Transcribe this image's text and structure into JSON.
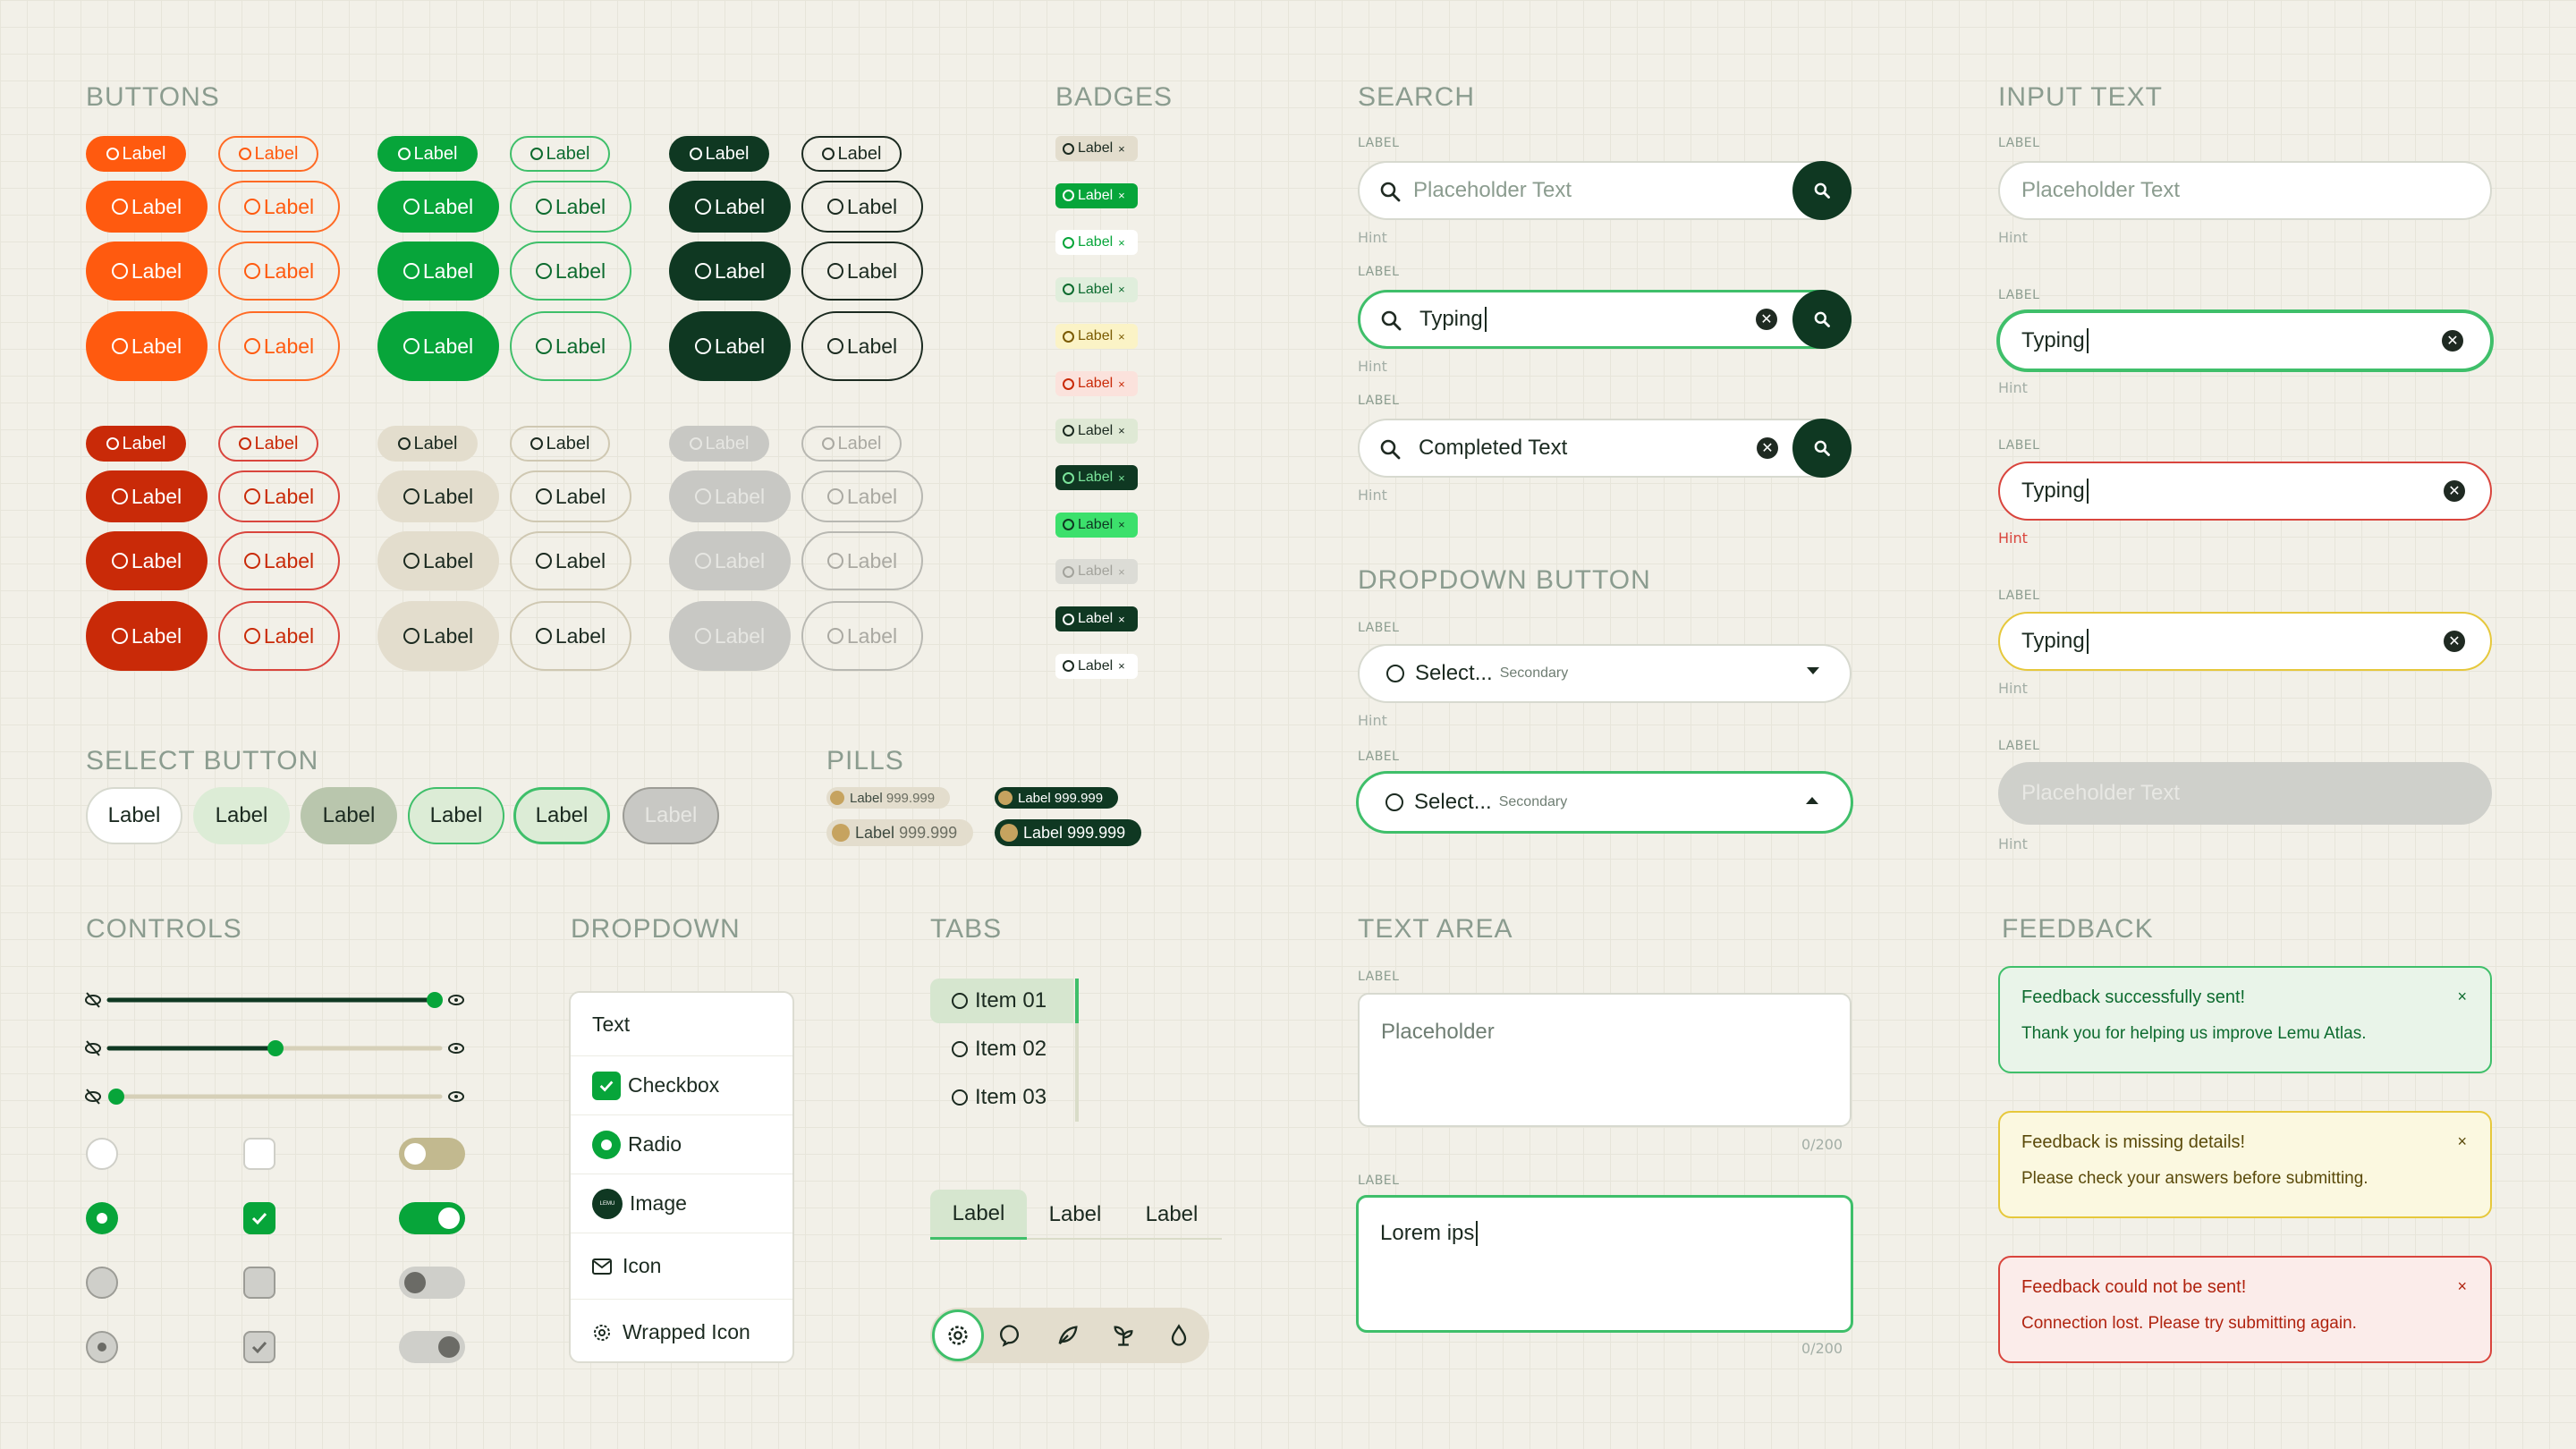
{
  "sections": {
    "buttons": "BUTTONS",
    "badges": "BADGES",
    "search": "SEARCH",
    "input_text": "INPUT TEXT",
    "select_button": "SELECT BUTTON",
    "pills": "PILLS",
    "dropdown_button": "DROPDOWN BUTTON",
    "controls": "CONTROLS",
    "dropdown": "DROPDOWN",
    "tabs": "TABS",
    "text_area": "TEXT AREA",
    "feedback": "FEEDBACK"
  },
  "buttons": {
    "label": "Label"
  },
  "badges": {
    "label": "Label",
    "close": "×"
  },
  "search": {
    "label": "LABEL",
    "hint": "Hint",
    "placeholder": "Placeholder Text",
    "typing": "Typing",
    "completed": "Completed Text"
  },
  "input_text": {
    "label": "LABEL",
    "hint": "Hint",
    "placeholder": "Placeholder Text",
    "typing": "Typing"
  },
  "select_button": {
    "label": "Label"
  },
  "pills": {
    "label": "Label",
    "value": "999.999"
  },
  "dropdown_button": {
    "label": "LABEL",
    "hint": "Hint",
    "select": "Select...",
    "secondary": "Secondary"
  },
  "dropdown": {
    "items": [
      "Text",
      "Checkbox",
      "Radio",
      "Image",
      "Icon",
      "Wrapped Icon"
    ],
    "image_text": "LEMU"
  },
  "tabs": {
    "vertical": [
      "Item 01",
      "Item 02",
      "Item 03"
    ],
    "horizontal": [
      "Label",
      "Label",
      "Label"
    ]
  },
  "text_area": {
    "label": "LABEL",
    "placeholder": "Placeholder",
    "value": "Lorem ips",
    "count": "0/200"
  },
  "feedback": [
    {
      "title": "Feedback successfully sent!",
      "message": "Thank you for helping us improve Lemu Atlas.",
      "close": "×",
      "status": "success"
    },
    {
      "title": "Feedback is missing details!",
      "message": "Please check your answers before submitting.",
      "close": "×",
      "status": "warning"
    },
    {
      "title": "Feedback could not be sent!",
      "message": "Connection lost. Please try submitting again.",
      "close": "×",
      "status": "error"
    }
  ],
  "colors": {
    "orange": "#ff5a0f",
    "green": "#07a53a",
    "dark": "#0f3822",
    "red": "#c92a08",
    "beige": "#e3ddcd",
    "disabled": "#c8c8c4",
    "background": "#f2f0e8",
    "success_bg": "#e9f4e9",
    "warning_bg": "#fbf8e0",
    "error_bg": "#fbecea"
  }
}
